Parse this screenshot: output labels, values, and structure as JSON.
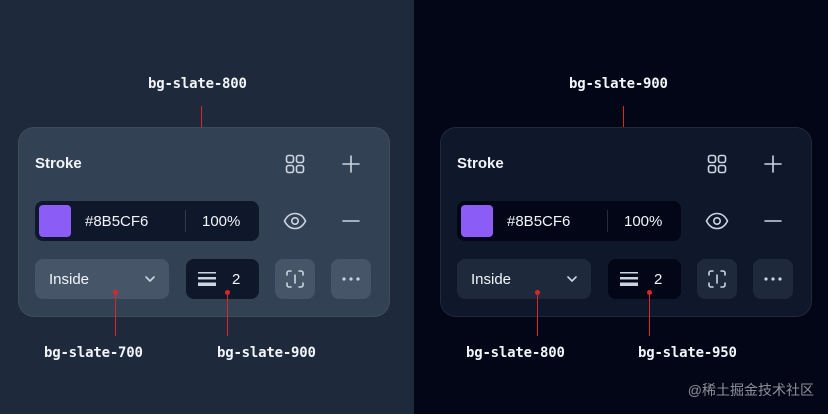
{
  "left": {
    "top_label": "bg-slate-800",
    "bottom_left_label": "bg-slate-700",
    "bottom_right_label": "bg-slate-900",
    "bg": "#1e293b",
    "panel_bg": "#334155",
    "control_bg": "#0f172a",
    "select_bg": "#334155"
  },
  "right": {
    "top_label": "bg-slate-900",
    "bottom_left_label": "bg-slate-800",
    "bottom_right_label": "bg-slate-950",
    "bg": "#020617",
    "panel_bg": "#0f172a",
    "control_bg": "#020617",
    "select_bg": "#1e293b"
  },
  "panel": {
    "title": "Stroke",
    "color_hex": "#8B5CF6",
    "opacity": "100%",
    "position": "Inside",
    "weight": "2",
    "swatch_color": "#8b5cf6",
    "icons": [
      "grid-icon",
      "plus-icon",
      "eye-icon",
      "minus-icon",
      "chevron-down-icon",
      "stroke-weight-icon",
      "stroke-sides-icon",
      "more-icon"
    ]
  },
  "watermark": "@稀土掘金技术社区"
}
